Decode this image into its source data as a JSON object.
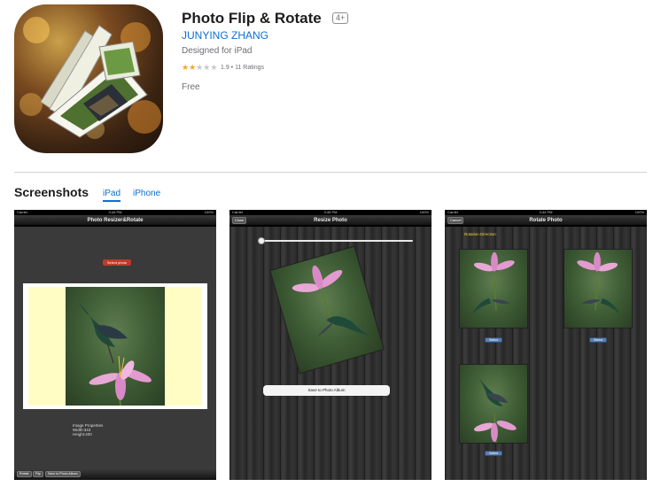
{
  "app": {
    "title": "Photo Flip & Rotate",
    "age_rating": "4+",
    "developer": "JUNYING ZHANG",
    "designed_for": "Designed for iPad",
    "rating_stars": 2,
    "rating_text": "1.9 • 11 Ratings",
    "price": "Free"
  },
  "screenshots_section": {
    "title": "Screenshots",
    "tabs": [
      "iPad",
      "iPhone"
    ],
    "active_tab": "iPad"
  },
  "screens": [
    {
      "carrier": "Carrier",
      "time": "3:44 PM",
      "battery": "100%",
      "nav_title": "Photo Resizer&Rotate",
      "select_button": "Select photo",
      "image_properties": [
        "Image Properties",
        "Width:343",
        "Height:400"
      ],
      "toolbar": [
        "Rotate",
        "Flip",
        "Save to Photo Album"
      ]
    },
    {
      "carrier": "Carrier",
      "time": "3:45 PM",
      "battery": "100%",
      "nav_title": "Resize Photo",
      "nav_button": "Close",
      "slider_value": 0.02,
      "save_button": "Save to Photo Album"
    },
    {
      "carrier": "Carrier",
      "time": "3:44 PM",
      "battery": "100%",
      "nav_title": "Rotate Photo",
      "nav_button": "Cancel",
      "direction_label": "Rotation Direction",
      "select_buttons": [
        "Select",
        "Select",
        "Select"
      ]
    }
  ],
  "colors": {
    "link": "#0a6fd1",
    "star": "#f5a623",
    "select_red": "#c0392b",
    "select_blue": "#5b7fb0"
  }
}
